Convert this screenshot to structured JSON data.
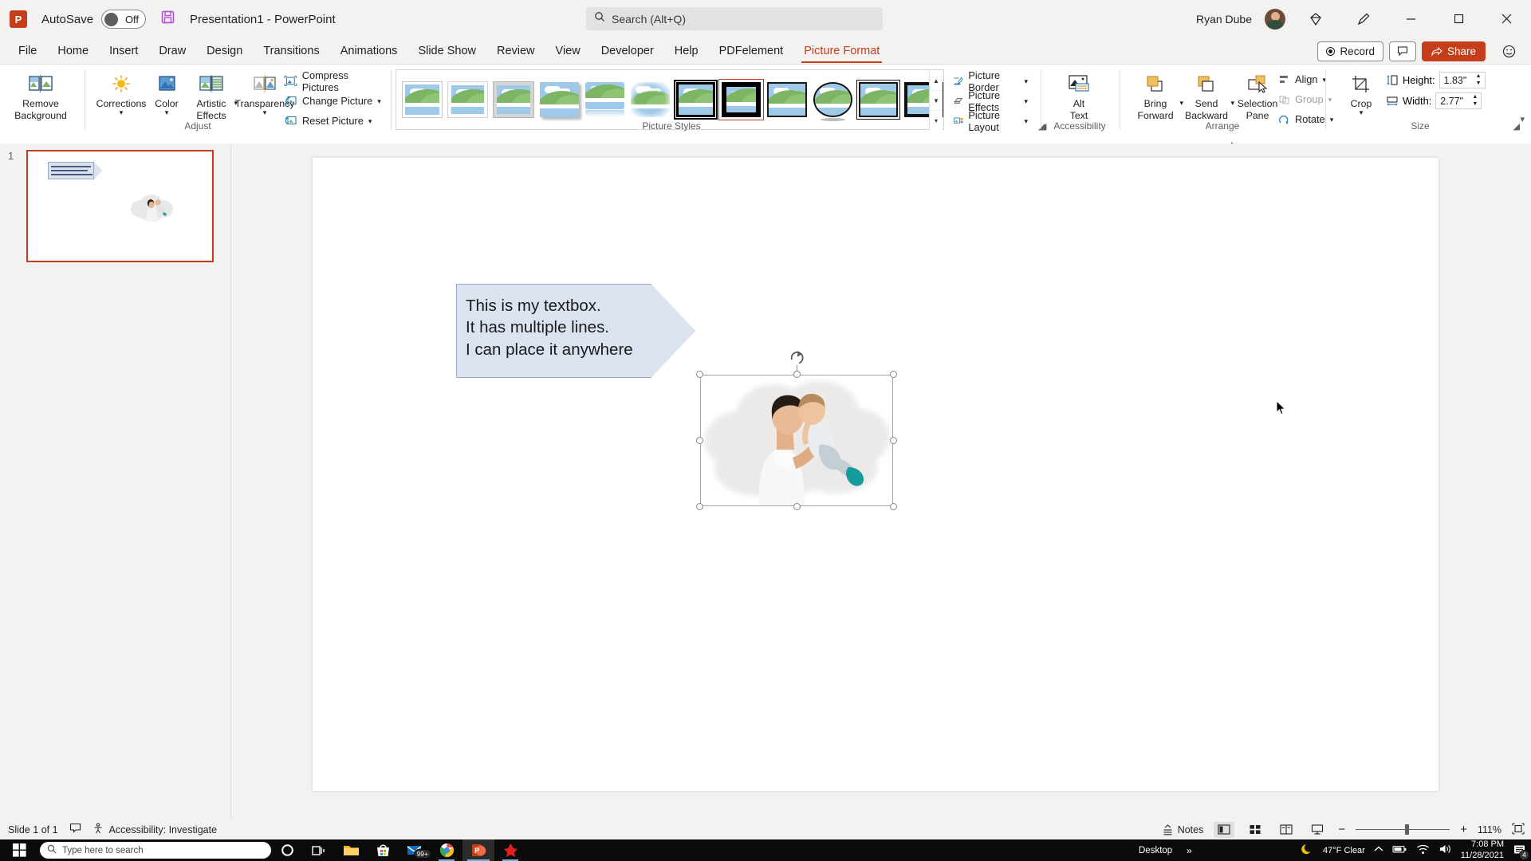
{
  "titlebar": {
    "app_icon": "powerpoint-logo",
    "autosave_label": "AutoSave",
    "autosave_state": "Off",
    "save_icon": "save-icon",
    "document_title": "Presentation1  -  PowerPoint",
    "search_placeholder": "Search (Alt+Q)",
    "search_icon": "search-icon",
    "user_name": "Ryan Dube",
    "ribbon_display_icon": "ribbon-display-options-icon",
    "pen_icon": "pen-icon",
    "minimize": "minimize-icon",
    "restore": "restore-icon",
    "close": "close-icon"
  },
  "tabs": [
    {
      "label": "File",
      "active": false
    },
    {
      "label": "Home",
      "active": false
    },
    {
      "label": "Insert",
      "active": false
    },
    {
      "label": "Draw",
      "active": false
    },
    {
      "label": "Design",
      "active": false
    },
    {
      "label": "Transitions",
      "active": false
    },
    {
      "label": "Animations",
      "active": false
    },
    {
      "label": "Slide Show",
      "active": false
    },
    {
      "label": "Review",
      "active": false
    },
    {
      "label": "View",
      "active": false
    },
    {
      "label": "Developer",
      "active": false
    },
    {
      "label": "Help",
      "active": false
    },
    {
      "label": "PDFelement",
      "active": false
    },
    {
      "label": "Picture Format",
      "active": true
    }
  ],
  "tabbar_right": {
    "record_label": "Record",
    "comments_icon": "comment-icon",
    "share_label": "Share",
    "emoji_icon": "feedback-smiley-icon"
  },
  "ribbon": {
    "groups": {
      "adjust": {
        "label": "Adjust",
        "remove_background": "Remove\nBackground",
        "corrections": "Corrections",
        "color": "Color",
        "artistic_effects": "Artistic\nEffects",
        "transparency": "Transparency",
        "compress_pictures": "Compress Pictures",
        "change_picture": "Change Picture",
        "reset_picture": "Reset Picture"
      },
      "picture_styles": {
        "label": "Picture Styles",
        "selected_index": 7,
        "styles": [
          "Simple Frame, White",
          "Beveled Matte, White",
          "Metal Frame",
          "Drop Shadow Rectangle",
          "Reflected Rounded Rectangle",
          "Soft Edge Rectangle",
          "Double Frame, Black",
          "Thick Matte, Black",
          "Simple Frame, Black",
          "Bevel Oval, Black",
          "Compound Frame, Black",
          "Moderate Frame, Black"
        ],
        "picture_border": "Picture Border",
        "picture_effects": "Picture Effects",
        "picture_layout": "Picture Layout"
      },
      "accessibility": {
        "label": "Accessibility",
        "alt_text": "Alt\nText"
      },
      "arrange": {
        "label": "Arrange",
        "bring_forward": "Bring\nForward",
        "send_backward": "Send\nBackward",
        "selection_pane": "Selection\nPane",
        "align": "Align",
        "group": "Group",
        "rotate": "Rotate"
      },
      "size": {
        "label": "Size",
        "crop": "Crop",
        "height_label": "Height:",
        "height_value": "1.83\"",
        "width_label": "Width:",
        "width_value": "2.77\""
      }
    },
    "collapse_icon": "collapse-ribbon-icon"
  },
  "thumbnail_pane": {
    "slide_number": "1"
  },
  "slide": {
    "textbox": {
      "text": "This is my textbox.\nIt has multiple lines.\nI can place it anywhere",
      "fill_color": "#dbe3f1",
      "border_color": "#9aa9c4",
      "shape": "pentagon-arrow"
    },
    "picture": {
      "name": "father-and-baby-photo",
      "style": "Cloud soft-edge mask",
      "selected": true,
      "handles": 8,
      "rotation_handle": true
    }
  },
  "statusbar": {
    "slide_count": "Slide 1 of 1",
    "notes_label": "Notes",
    "accessibility": "Accessibility: Investigate",
    "accessibility_icon": "accessibility-icon",
    "language_icon": "language-icon",
    "views": [
      {
        "name": "normal-view",
        "selected": true
      },
      {
        "name": "slide-sorter-view",
        "selected": false
      },
      {
        "name": "reading-view",
        "selected": false
      },
      {
        "name": "slide-show-view",
        "selected": false
      }
    ],
    "zoom_out": "−",
    "zoom_in": "+",
    "zoom_level": "111%",
    "fit_slide_icon": "fit-slide-to-window-icon"
  },
  "taskbar": {
    "start_icon": "windows-start-icon",
    "search_placeholder": "Type here to search",
    "search_icon": "search-icon",
    "items": [
      {
        "name": "cortana-icon"
      },
      {
        "name": "task-view-icon"
      },
      {
        "name": "file-explorer-icon"
      },
      {
        "name": "microsoft-store-icon"
      },
      {
        "name": "mail-icon",
        "badge": "99+"
      },
      {
        "name": "google-chrome-icon"
      },
      {
        "name": "powerpoint-icon",
        "active": true
      },
      {
        "name": "wondershare-icon"
      }
    ],
    "desktop_label": "Desktop",
    "tray": {
      "weather_icon": "moon-icon",
      "weather": "47°F  Clear",
      "chevron_icon": "show-hidden-icons-icon",
      "battery_icon": "battery-icon",
      "wifi_icon": "wifi-icon",
      "volume_icon": "volume-icon",
      "time": "7:08 PM",
      "date": "11/28/2021",
      "notification_icon": "notifications-icon",
      "notification_count": "4"
    }
  }
}
